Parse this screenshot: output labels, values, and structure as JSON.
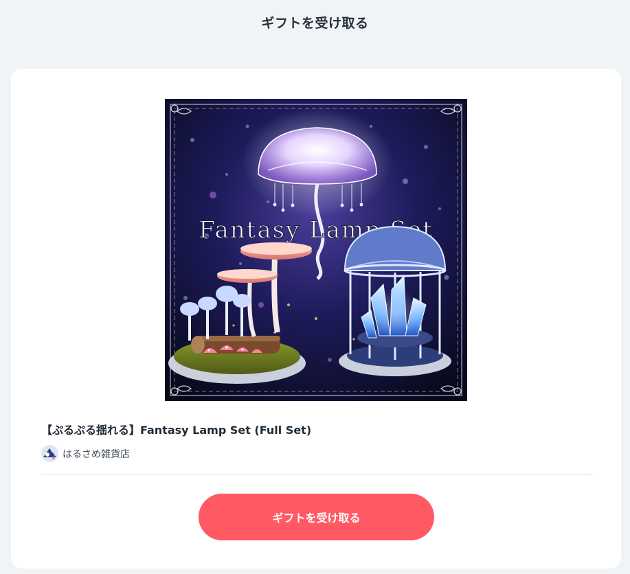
{
  "header": {
    "title": "ギフトを受け取る"
  },
  "product": {
    "image_icon": "fantasy-lamp-set-thumbnail",
    "image_title": "Fantasy Lamp Set",
    "name": "【ぷるぷる揺れる】Fantasy Lamp Set (Full Set)",
    "shop": {
      "avatar_icon": "shop-avatar",
      "name": "はるさめ雑貨店"
    }
  },
  "action": {
    "receive_label": "ギフトを受け取る"
  },
  "colors": {
    "page_background": "#f1f4f7",
    "card_background": "#ffffff",
    "button": "#ff5a63",
    "button_text": "#ffffff",
    "title_text": "#26303a"
  }
}
